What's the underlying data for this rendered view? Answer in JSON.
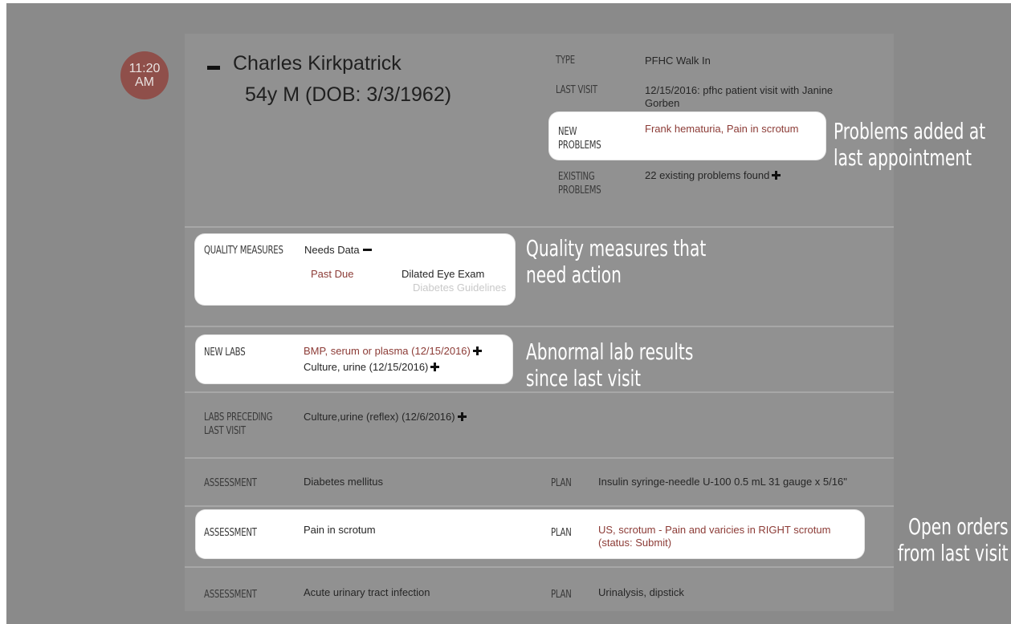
{
  "appointment": {
    "time_hour": "11:20",
    "time_period": "AM",
    "patient_name": "Charles Kirkpatrick",
    "patient_demographics": "54y M (DOB: 3/3/1962)"
  },
  "details": {
    "type_label": "TYPE",
    "type_value": "PFHC Walk In",
    "last_visit_label": "LAST VISIT",
    "last_visit_value": "12/15/2016: pfhc patient visit with Janine Gorben",
    "new_problems_label": "NEW PROBLEMS",
    "new_problems_value": "Frank hematuria, Pain in scrotum",
    "existing_problems_label": "EXISTING PROBLEMS",
    "existing_problems_value": "22 existing problems found"
  },
  "quality": {
    "label": "QUALITY MEASURES",
    "status": "Needs Data",
    "past_due": "Past Due",
    "measure": "Dilated Eye Exam",
    "guideline": "Diabetes Guidelines"
  },
  "labs": {
    "new_label": "NEW LABS",
    "new_items": [
      "BMP, serum or plasma (12/15/2016)",
      "Culture, urine (12/15/2016)"
    ],
    "preceding_label": "LABS PRECEDING LAST VISIT",
    "preceding_items": [
      "Culture,urine (reflex) (12/6/2016)"
    ]
  },
  "orders": [
    {
      "assessment_label": "ASSESSMENT",
      "assessment": "Diabetes mellitus",
      "plan_label": "PLAN",
      "plan": "Insulin syringe-needle U-100 0.5 mL 31 gauge x 5/16\""
    },
    {
      "assessment_label": "ASSESSMENT",
      "assessment": "Pain in scrotum",
      "plan_label": "PLAN",
      "plan": "US, scrotum - Pain and varicies in RIGHT scrotum (status: Submit)"
    },
    {
      "assessment_label": "ASSESSMENT",
      "assessment": "Acute urinary tract infection",
      "plan_label": "PLAN",
      "plan": "Urinalysis, dipstick"
    }
  ],
  "callouts": {
    "problems": "Problems added at last appointment",
    "quality": "Quality measures that need action",
    "labs": "Abnormal lab results since last visit",
    "orders": "Open orders from last visit"
  },
  "colors": {
    "overlay": "#8a8a8a",
    "card": "#919191",
    "badge": "#8f4f4a",
    "alert_text": "#8c3b36",
    "highlight": "#ffffff"
  },
  "icons": [
    "collapse-icon",
    "minus-icon",
    "plus-icon"
  ]
}
